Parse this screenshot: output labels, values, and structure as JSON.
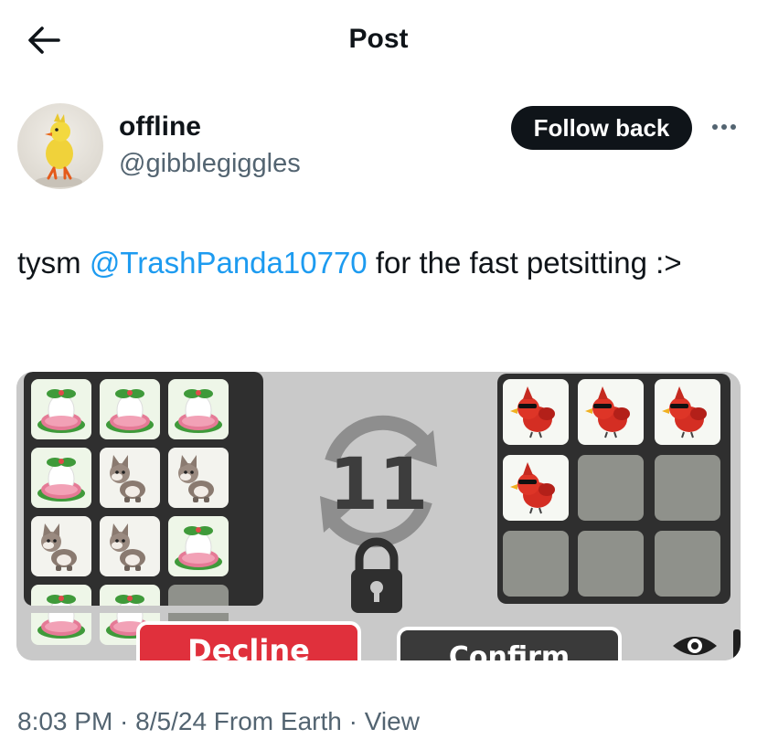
{
  "header": {
    "title": "Post",
    "back_icon": "arrow-left-icon"
  },
  "author": {
    "display_name": "offline",
    "handle": "@gibblegiggles",
    "follow_label": "Follow back",
    "more_icon": "more-dots-icon"
  },
  "tweet": {
    "prefix": "tysm ",
    "mention": "@TrashPanda10770",
    "suffix": " for the fast petsitting :>"
  },
  "media": {
    "trade_count": "11",
    "decline_label": "Decline",
    "confirm_label": "Confirm",
    "left_items": [
      "egg",
      "egg",
      "egg",
      "egg",
      "fox",
      "fox",
      "fox",
      "fox",
      "egg",
      "egg",
      "egg",
      "empty"
    ],
    "right_items": [
      "cardinal",
      "cardinal",
      "cardinal",
      "cardinal",
      "empty",
      "empty",
      "empty",
      "empty",
      "empty"
    ]
  },
  "meta": {
    "time": "8:03 PM",
    "sep1": " · ",
    "date": "8/5/24",
    "source": " From Earth",
    "sep2": " · ",
    "view": "View"
  },
  "colors": {
    "link": "#1d9bf0",
    "decline": "#e0303c",
    "confirm": "#3a3a3a",
    "muted": "#536471"
  }
}
